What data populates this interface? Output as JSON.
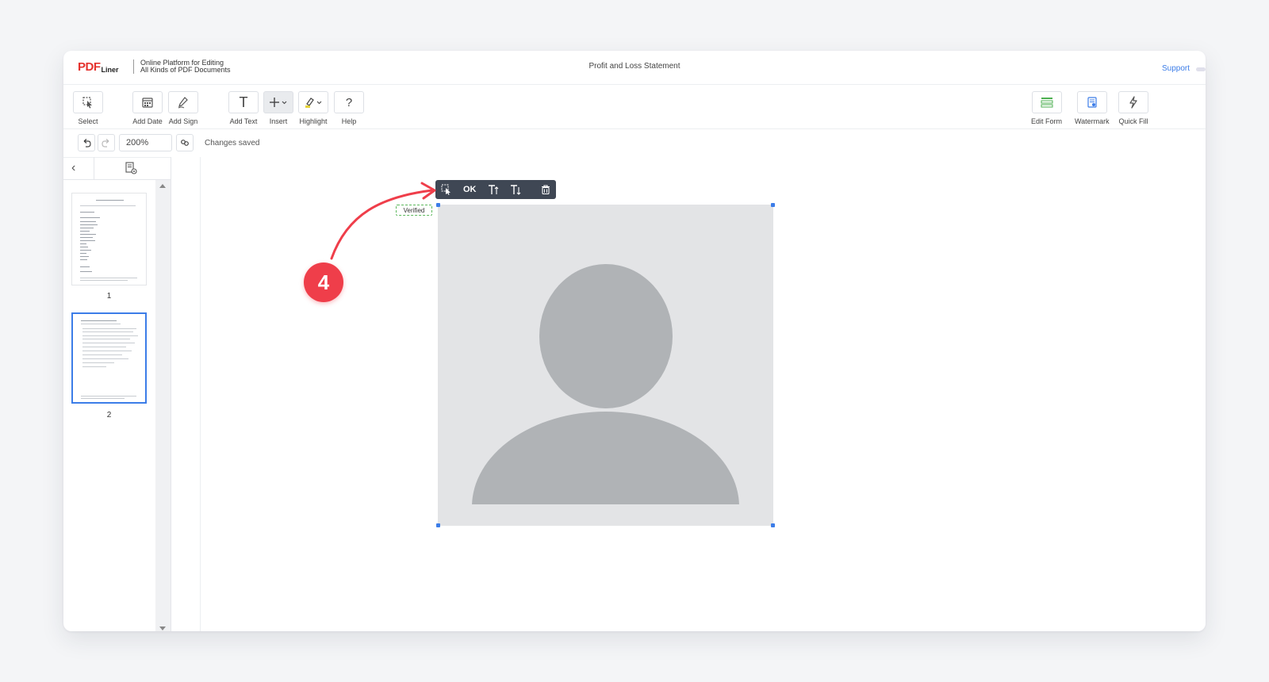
{
  "header": {
    "logo_pdf": "PDF",
    "logo_liner": "Liner",
    "tagline_line1": "Online Platform for Editing",
    "tagline_line2": "All Kinds of PDF Documents",
    "doc_title": "Profit and Loss Statement",
    "support": "Support"
  },
  "toolbar": {
    "select": "Select",
    "add_date": "Add Date",
    "add_sign": "Add Sign",
    "add_text": "Add Text",
    "insert": "Insert",
    "highlight": "Highlight",
    "help": "Help",
    "help_glyph": "?",
    "text_glyph": "T",
    "edit_form": "Edit Form",
    "watermark": "Watermark",
    "quick_fill": "Quick Fill"
  },
  "subtoolbar": {
    "zoom": "200%",
    "status": "Changes saved"
  },
  "sidebar": {
    "pages": [
      {
        "number": "1"
      },
      {
        "number": "2"
      }
    ]
  },
  "editor": {
    "verified_label": "Verified",
    "field_toolbar": {
      "ok": "OK"
    },
    "step_number": "4"
  },
  "colors": {
    "accent": "#3c7de8",
    "brand_red": "#e5322d",
    "annotation": "#ef3e4a",
    "toolbar_dark": "#3f4754",
    "edit_form_icon": "#4caf50"
  }
}
